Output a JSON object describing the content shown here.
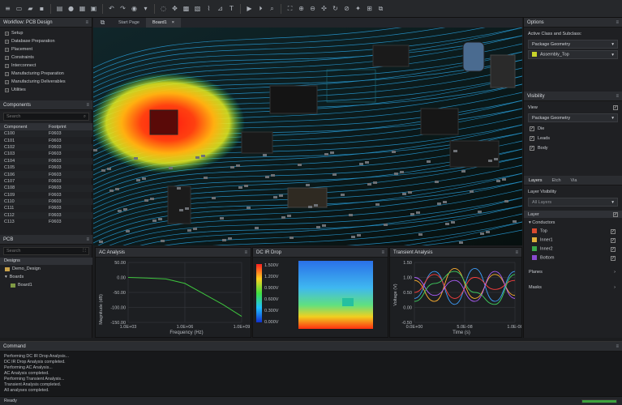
{
  "toolbar": {
    "file_menu": "≡",
    "caret": "▾"
  },
  "workflow": {
    "title": "Workflow: PCB Design",
    "items": [
      "Setup",
      "Database Preparation",
      "Placement",
      "Constraints",
      "Interconnect",
      "Manufacturing Preparation",
      "Manufacturing Deliverables",
      "Utilities"
    ]
  },
  "components": {
    "title": "Components",
    "search_placeholder": "Search",
    "headers": [
      "Component",
      "Footprint"
    ],
    "rows": [
      [
        "C100",
        "F0603"
      ],
      [
        "C101",
        "F0603"
      ],
      [
        "C102",
        "F0603"
      ],
      [
        "C103",
        "F0603"
      ],
      [
        "C104",
        "F0603"
      ],
      [
        "C105",
        "F0603"
      ],
      [
        "C106",
        "F0603"
      ],
      [
        "C107",
        "F0603"
      ],
      [
        "C108",
        "F0603"
      ],
      [
        "C109",
        "F0603"
      ],
      [
        "C110",
        "F0603"
      ],
      [
        "C111",
        "F0603"
      ],
      [
        "C112",
        "F0603"
      ],
      [
        "C113",
        "F0603"
      ]
    ]
  },
  "pcb": {
    "title": "PCB",
    "search_placeholder": "Search",
    "designs_label": "Designs",
    "design_name": "Demo_Design",
    "boards_label": "Boards",
    "board_name": "Board1"
  },
  "doc_tabs": [
    {
      "label": "Start Page"
    },
    {
      "label": "Board1"
    }
  ],
  "tab_close": "×",
  "analyses": {
    "ac": {
      "title": "AC Analysis",
      "xlabel": "Frequency (Hz)",
      "ylabel": "Magnitude (dB)",
      "xticks": [
        "1.0E+03",
        "1.0E+06",
        "1.0E+09"
      ],
      "yticks": [
        "50.00",
        "0.00",
        "-50.00",
        "-100.00",
        "-150.00"
      ]
    },
    "ir": {
      "title": "DC IR Drop",
      "scale": [
        "1.500V",
        "1.200V",
        "0.900V",
        "0.600V",
        "0.300V",
        "0.000V"
      ]
    },
    "tr": {
      "title": "Transient Analysis",
      "xlabel": "Time (s)",
      "ylabel": "Voltage (V)",
      "xticks": [
        "0.0E+00",
        "5.0E-08",
        "1.0E-08"
      ],
      "yticks": [
        "1.50",
        "1.00",
        "0.50",
        "0.00",
        "-0.50"
      ]
    }
  },
  "chart_data": [
    {
      "type": "line",
      "title": "AC Analysis",
      "xlabel": "Frequency (Hz)",
      "ylabel": "Magnitude (dB)",
      "x_scale": "log",
      "x": [
        1000,
        10000,
        100000,
        1000000,
        10000000,
        100000000,
        1000000000
      ],
      "series": [
        {
          "values": [
            0,
            -2,
            -5,
            -20,
            -55,
            -90,
            -130
          ]
        }
      ],
      "ylim": [
        -150,
        50
      ]
    },
    {
      "type": "line",
      "title": "Transient Analysis",
      "xlabel": "Time (s)",
      "ylabel": "Voltage (V)",
      "series": [
        {
          "color": "#3ea0ff",
          "values": [
            0.3,
            1.2,
            0.1,
            1.3,
            0.2,
            1.2
          ]
        },
        {
          "color": "#ffb030",
          "values": [
            0.9,
            0.2,
            1.3,
            0.3,
            1.1,
            0.4
          ]
        },
        {
          "color": "#ff4040",
          "values": [
            0.5,
            1.1,
            0.3,
            1.0,
            0.6,
            0.9
          ]
        },
        {
          "color": "#b060ff",
          "values": [
            1.0,
            0.4,
            0.9,
            0.2,
            1.2,
            0.3
          ]
        },
        {
          "color": "#40d060",
          "values": [
            0.2,
            0.8,
            1.2,
            0.5,
            0.1,
            1.1
          ]
        }
      ]
    }
  ],
  "options": {
    "title": "Options",
    "active_label": "Active Class and Subclass:",
    "class_value": "Package Geometry",
    "subclass_value": "Assembly_Top"
  },
  "visibility": {
    "title": "Visibility",
    "view_label": "View",
    "view_value": "Package Geometry",
    "checks": [
      "Die",
      "Leads",
      "Body"
    ]
  },
  "layers": {
    "tabs": [
      "Layers",
      "Etch",
      "Via"
    ],
    "layer_visibility": "Layer Visibility",
    "all_layers": "All Layers",
    "layer_label": "Layer",
    "conductors": "Conductors",
    "items": [
      {
        "name": "Top",
        "color": "#d84a2f"
      },
      {
        "name": "Inner1",
        "color": "#e0b03a"
      },
      {
        "name": "Inner2",
        "color": "#3aa84a"
      },
      {
        "name": "Bottom",
        "color": "#8a4ad0"
      }
    ],
    "planes": "Planes",
    "masks": "Masks"
  },
  "command": {
    "title": "Command",
    "lines": [
      "Performing DC IR Drop Analysis...",
      "DC IR Drop Analysis completed.",
      "Performing AC Analysis...",
      "AC Analysis completed.",
      "Performing Transient Analysis...",
      "Transient Analysis completed.",
      "All analyses completed."
    ]
  },
  "status": {
    "text": "Ready",
    "progress": 1.0
  }
}
